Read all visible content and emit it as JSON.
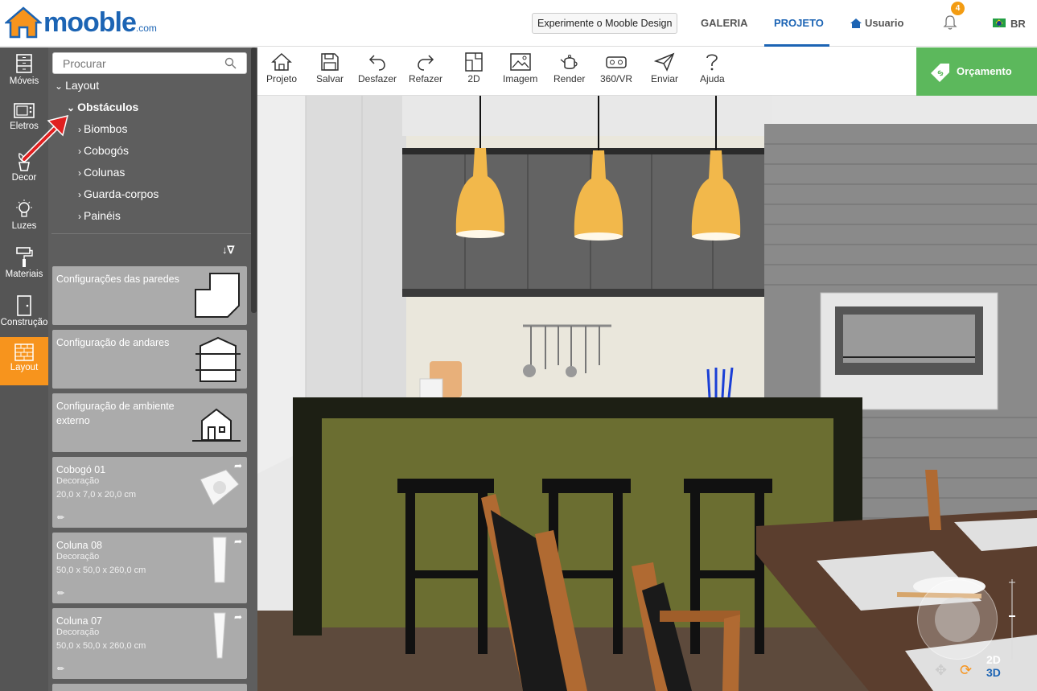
{
  "header": {
    "logo_text": "mooble",
    "logo_suffix": ".com",
    "try_button": "Experimente o Mooble Design",
    "nav_gallery": "GALERIA",
    "nav_project": "PROJETO",
    "nav_user": "Usuario",
    "notification_count": "4",
    "language": "BR"
  },
  "rail": {
    "items": [
      {
        "label": "Móveis",
        "icon": "furniture-icon"
      },
      {
        "label": "Eletros",
        "icon": "appliance-icon"
      },
      {
        "label": "Decor",
        "icon": "plant-icon"
      },
      {
        "label": "Luzes",
        "icon": "bulb-icon"
      },
      {
        "label": "Materiais",
        "icon": "paint-roller-icon"
      },
      {
        "label": "Construção",
        "icon": "door-icon"
      },
      {
        "label": "Layout",
        "icon": "brick-icon",
        "active": true
      }
    ]
  },
  "library": {
    "search_placeholder": "Procurar",
    "tree": {
      "root": "Layout",
      "open_category": "Obstáculos",
      "subcategories": [
        "Biombos",
        "Cobogós",
        "Colunas",
        "Guarda-corpos",
        "Painéis"
      ]
    },
    "cards": [
      {
        "title": "Configurações das paredes"
      },
      {
        "title": "Configuração de andares"
      },
      {
        "title": "Configuração de ambiente externo"
      },
      {
        "title": "Cobogó 01",
        "category": "Decoração",
        "dims": "20,0 x 7,0 x 20,0 cm"
      },
      {
        "title": "Coluna 08",
        "category": "Decoração",
        "dims": "50,0 x 50,0 x 260,0 cm"
      },
      {
        "title": "Coluna 07",
        "category": "Decoração",
        "dims": "50,0 x 50,0 x 260,0 cm"
      }
    ]
  },
  "toolbar": {
    "tools": [
      "Projeto",
      "Salvar",
      "Desfazer",
      "Refazer",
      "2D",
      "Imagem",
      "Render",
      "360/VR",
      "Enviar",
      "Ajuda"
    ],
    "quote_button": "Orçamento"
  },
  "viewport": {
    "toggle_2d": "2D",
    "toggle_3d": "3D"
  },
  "colors": {
    "brand_blue": "#1c64b4",
    "accent_orange": "#f7941d",
    "quote_green": "#5cb85c"
  }
}
